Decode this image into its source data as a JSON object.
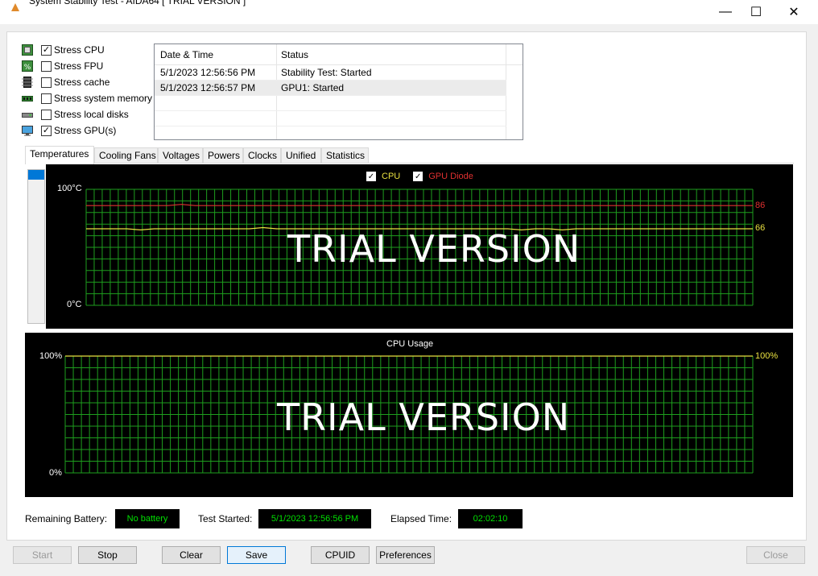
{
  "window": {
    "title": "System Stability Test - AIDA64  [ TRIAL VERSION ]",
    "minimize_label": "—",
    "maximize_label": "☐",
    "close_label": "✕"
  },
  "stress_options": [
    {
      "label": "Stress CPU",
      "checked": true,
      "icon": "cpu-chip-icon"
    },
    {
      "label": "Stress FPU",
      "checked": false,
      "icon": "fpu-chip-icon"
    },
    {
      "label": "Stress cache",
      "checked": false,
      "icon": "cache-chip-icon"
    },
    {
      "label": "Stress system memory",
      "checked": false,
      "icon": "memory-module-icon"
    },
    {
      "label": "Stress local disks",
      "checked": false,
      "icon": "disk-drive-icon"
    },
    {
      "label": "Stress GPU(s)",
      "checked": true,
      "icon": "monitor-icon"
    }
  ],
  "log": {
    "col_datetime": "Date & Time",
    "col_status": "Status",
    "rows": [
      {
        "datetime": "5/1/2023 12:56:56 PM",
        "status": "Stability Test: Started"
      },
      {
        "datetime": "5/1/2023 12:56:57 PM",
        "status": "GPU1: Started"
      }
    ]
  },
  "tabs": [
    "Temperatures",
    "Cooling Fans",
    "Voltages",
    "Powers",
    "Clocks",
    "Unified",
    "Statistics"
  ],
  "active_tab": "Temperatures",
  "temp_chart": {
    "legend": [
      {
        "name": "CPU",
        "color": "#e8e040",
        "checked": true
      },
      {
        "name": "GPU Diode",
        "color": "#e03030",
        "checked": true
      }
    ],
    "y_max_label": "100°C",
    "y_min_label": "0°C",
    "watermark": "TRIAL VERSION",
    "gpu_value_label": "86",
    "cpu_value_label": "66"
  },
  "usage_chart": {
    "title": "CPU Usage",
    "y_max_label": "100%",
    "y_min_label": "0%",
    "value_label": "100%",
    "watermark": "TRIAL VERSION"
  },
  "chart_data": [
    {
      "type": "line",
      "ylim": [
        0,
        100
      ],
      "unit": "°C",
      "grid": true,
      "series": [
        {
          "name": "CPU",
          "color": "#e8e040",
          "values": [
            66,
            66,
            66,
            66,
            65,
            66,
            66,
            66,
            66,
            66,
            66,
            66,
            66,
            67,
            66,
            66,
            66,
            66,
            66,
            66,
            66,
            66,
            66,
            66,
            66,
            66,
            66,
            66,
            66,
            66,
            66,
            66,
            65,
            66,
            66,
            65,
            66,
            66,
            66,
            66,
            66,
            66,
            66,
            66,
            66,
            66,
            66,
            66,
            66,
            66
          ],
          "current": 66
        },
        {
          "name": "GPU Diode",
          "color": "#e03030",
          "values": [
            86,
            86,
            86,
            86,
            86,
            86,
            86,
            87,
            86,
            86,
            86,
            86,
            86,
            86,
            86,
            86,
            86,
            86,
            86,
            86,
            86,
            86,
            86,
            86,
            86,
            86,
            86,
            86,
            86,
            86,
            86,
            86,
            86,
            86,
            86,
            86,
            86,
            86,
            86,
            86,
            86,
            86,
            86,
            86,
            86,
            86,
            86,
            86,
            86,
            86
          ],
          "current": 86
        }
      ]
    },
    {
      "type": "line",
      "title": "CPU Usage",
      "ylim": [
        0,
        100
      ],
      "unit": "%",
      "grid": true,
      "series": [
        {
          "name": "CPU Usage",
          "color": "#e8e040",
          "values": [
            100,
            100,
            100,
            100,
            100,
            100,
            100,
            100,
            100,
            100,
            100,
            100,
            100,
            100,
            100,
            100,
            100,
            100,
            100,
            100,
            100,
            100,
            100,
            100,
            100,
            100,
            100,
            100,
            100,
            100
          ],
          "current": 100
        }
      ]
    }
  ],
  "status": {
    "battery_label": "Remaining Battery:",
    "battery_value": "No battery",
    "started_label": "Test Started:",
    "started_value": "5/1/2023 12:56:56 PM",
    "elapsed_label": "Elapsed Time:",
    "elapsed_value": "02:02:10"
  },
  "buttons": {
    "start": "Start",
    "stop": "Stop",
    "clear": "Clear",
    "save": "Save",
    "cpuid": "CPUID",
    "preferences": "Preferences",
    "close": "Close"
  },
  "colors": {
    "grid": "#1e9e1e",
    "accent": "#0078d7",
    "lcd_text": "#00e000"
  }
}
